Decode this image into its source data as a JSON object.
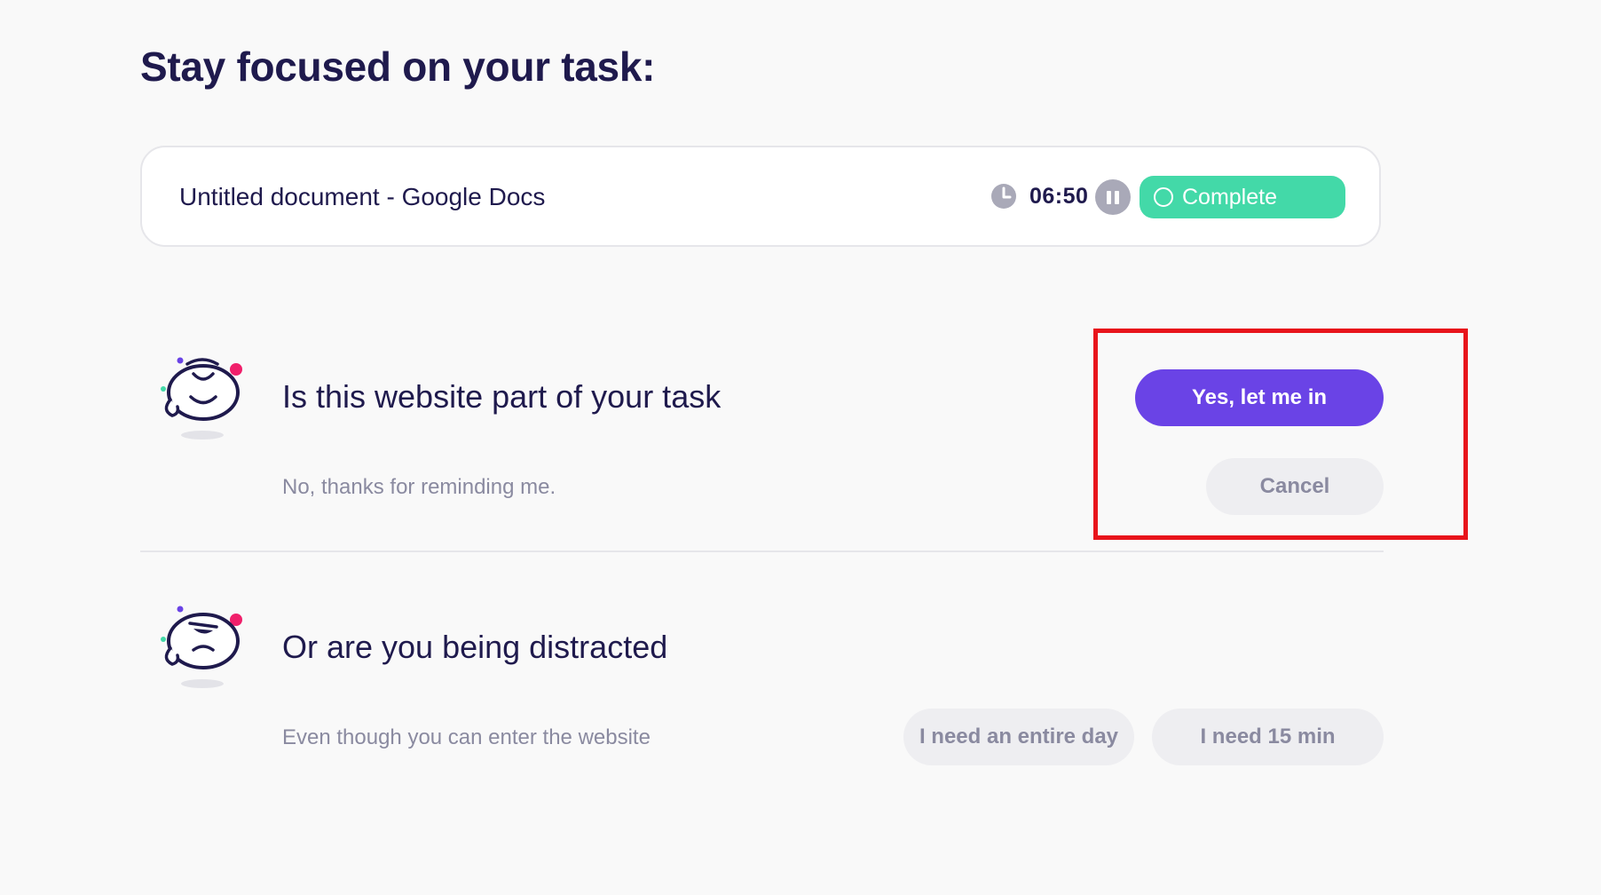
{
  "page_title": "Stay focused on your task:",
  "task": {
    "name": "Untitled document - Google Docs",
    "timer": "06:50",
    "complete_label": "Complete"
  },
  "question": {
    "heading": "Is this website part of your task",
    "subtext": "No, thanks for reminding me.",
    "yes_label": "Yes, let me in",
    "cancel_label": "Cancel"
  },
  "distracted": {
    "heading": "Or are you being distracted",
    "subtext": "Even though you can enter the website",
    "entire_day_label": "I need an entire day",
    "fifteen_min_label": "I need 15 min"
  },
  "colors": {
    "primary": "#6a43e6",
    "complete": "#43d9a8",
    "text_dark": "#1f1a4d",
    "text_muted": "#8a8aa0",
    "highlight": "#e8141b"
  },
  "icons": {
    "clock": "clock-icon",
    "pause": "pause-icon",
    "complete": "circle-outline-icon",
    "mascot_happy": "mascot-happy-icon",
    "mascot_annoyed": "mascot-annoyed-icon"
  }
}
